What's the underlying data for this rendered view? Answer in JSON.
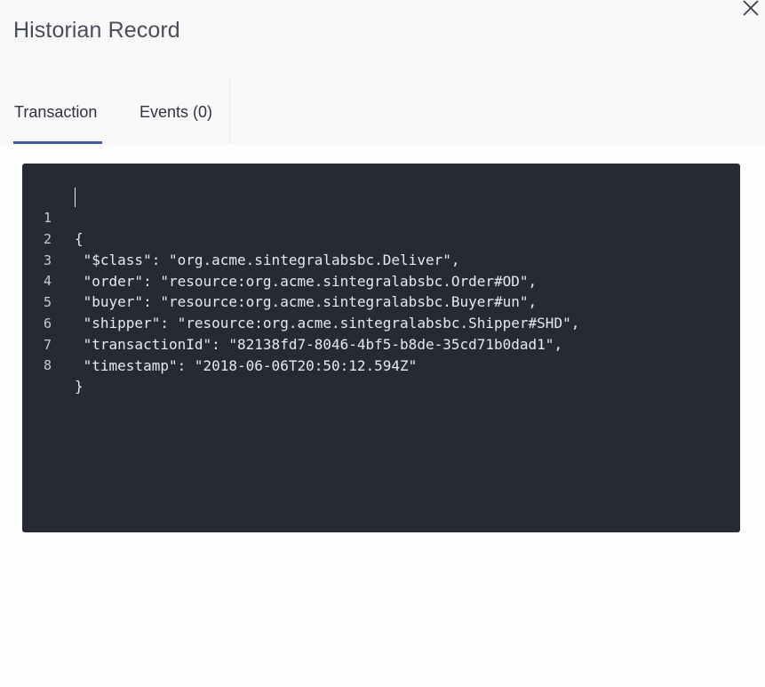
{
  "dialog": {
    "title": "Historian Record",
    "close_icon": "close-icon"
  },
  "tabs": [
    {
      "label": "Transaction",
      "active": true
    },
    {
      "label": "Events (0)",
      "active": false
    }
  ],
  "colors": {
    "accent": "#3d5ba8",
    "editor_background": "#262a35"
  },
  "editor": {
    "lines": [
      {
        "number": "1",
        "text": "{"
      },
      {
        "number": "2",
        "text": " \"$class\": \"org.acme.sintegralabsbc.Deliver\","
      },
      {
        "number": "3",
        "text": " \"order\": \"resource:org.acme.sintegralabsbc.Order#OD\","
      },
      {
        "number": "4",
        "text": " \"buyer\": \"resource:org.acme.sintegralabsbc.Buyer#un\","
      },
      {
        "number": "5",
        "text": " \"shipper\": \"resource:org.acme.sintegralabsbc.Shipper#SHD\","
      },
      {
        "number": "6",
        "text": " \"transactionId\": \"82138fd7-8046-4bf5-b8de-35cd71b0dad1\","
      },
      {
        "number": "7",
        "text": " \"timestamp\": \"2018-06-06T20:50:12.594Z\""
      },
      {
        "number": "8",
        "text": "}"
      }
    ]
  }
}
